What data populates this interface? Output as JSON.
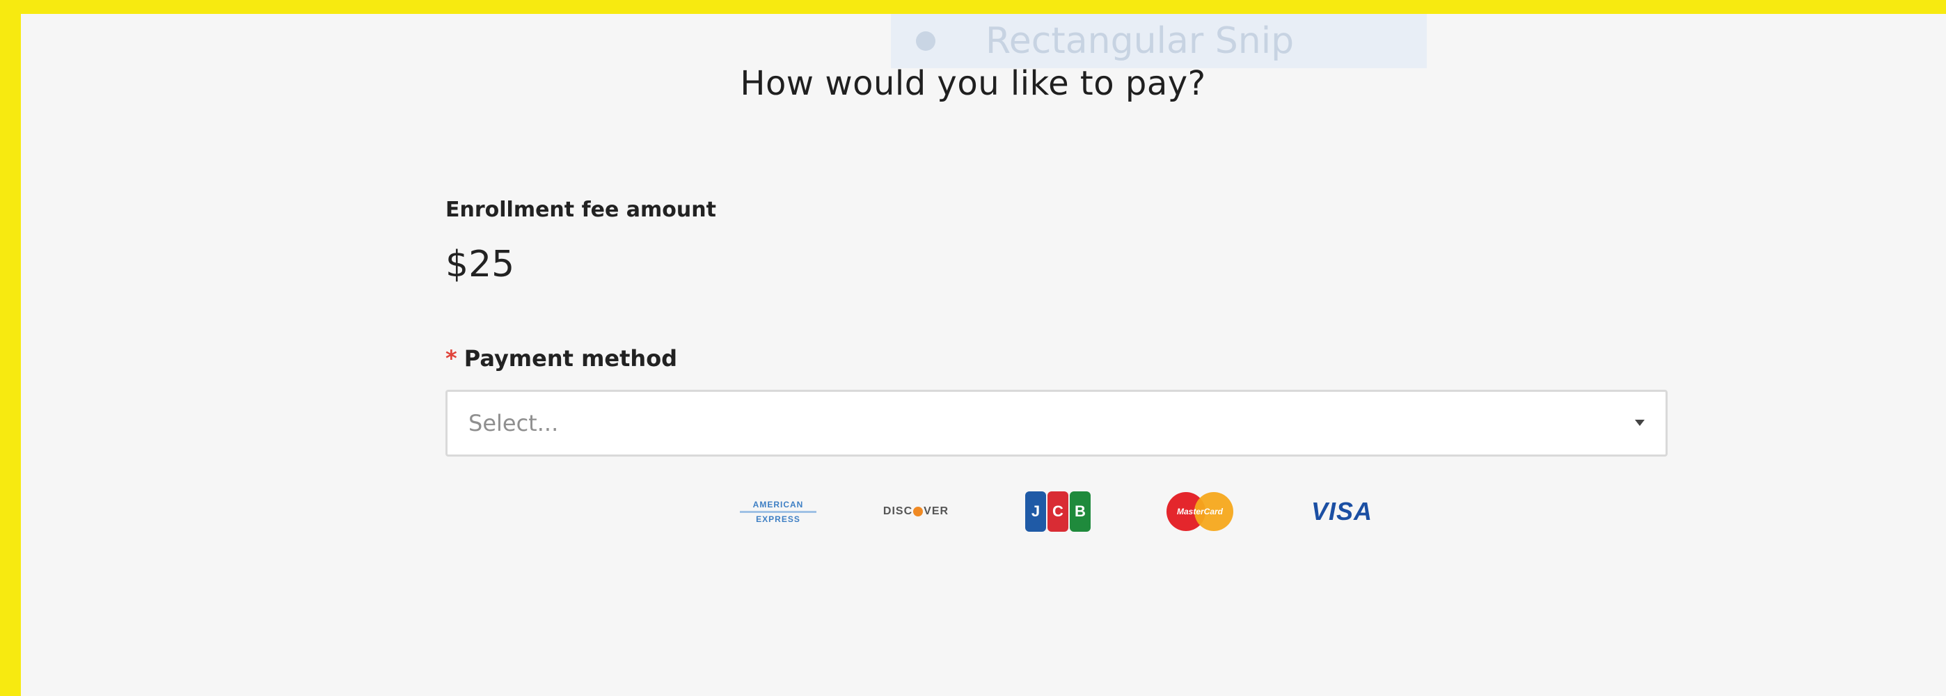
{
  "overlay": {
    "snip_label": "Rectangular Snip"
  },
  "header": {
    "title": "How would you like to pay?"
  },
  "fee": {
    "label": "Enrollment fee amount",
    "amount": "$25"
  },
  "payment": {
    "required_marker": "*",
    "label": "Payment method",
    "select_placeholder": "Select..."
  },
  "card_brands": {
    "amex_line1": "AMERICAN",
    "amex_line2": "EXPRESS",
    "discover_pre": "DISC",
    "discover_post": "VER",
    "jcb_letters": [
      "J",
      "C",
      "B"
    ],
    "jcb_colors": [
      "#1f5aa6",
      "#d92c34",
      "#1f8a3c"
    ],
    "mastercard_text": "MasterCard",
    "visa": "VISA"
  },
  "colors": {
    "frame_border": "#f7ea10",
    "background": "#f6f6f6",
    "required": "#e0433a"
  },
  "icons": {
    "select_caret": "chevron-down-icon",
    "snip_tool": "snip-icon"
  }
}
